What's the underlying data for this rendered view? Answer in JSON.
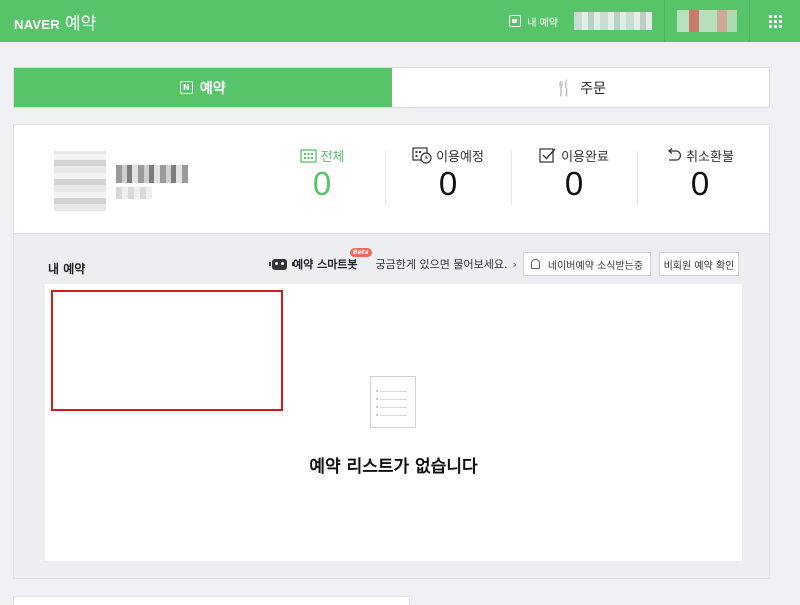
{
  "header": {
    "brand": "NAVER",
    "service": "예약",
    "my_reservation_link": "내 예약",
    "colors": {
      "primary": "#58c46a"
    },
    "icons": [
      "calendar-icon",
      "apps-grid-icon"
    ]
  },
  "tabs": [
    {
      "label": "예약",
      "icon": "calendar-n-icon",
      "active": true
    },
    {
      "label": "주문",
      "icon": "fork-knife-icon",
      "active": false
    }
  ],
  "summary": {
    "stats": [
      {
        "label": "전체",
        "value": "0",
        "icon": "calendar-grid-icon",
        "active": true
      },
      {
        "label": "이용예정",
        "value": "0",
        "icon": "calendar-clock-icon"
      },
      {
        "label": "이용완료",
        "value": "0",
        "icon": "checkbox-icon"
      },
      {
        "label": "취소환불",
        "value": "0",
        "icon": "undo-arrow-icon"
      }
    ]
  },
  "section": {
    "title": "내 예약",
    "bot_name": "예약 스마트봇",
    "bot_badge": "Beta",
    "bot_desc": "궁금한게 있으면 물어보세요.",
    "news_button": "네이버예약 소식받는중",
    "guest_button": "비회원 예약 확인",
    "empty_message": "예약 리스트가 없습니다"
  }
}
